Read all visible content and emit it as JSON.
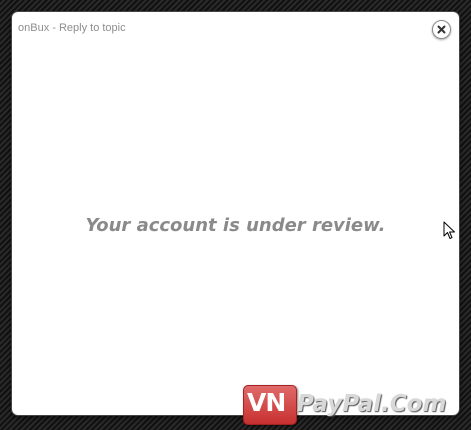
{
  "dialog": {
    "title": "onBux - Reply to topic",
    "message": "Your account is under review."
  },
  "watermark": {
    "prefix": "VN",
    "rest": "PayPal.Com"
  },
  "colors": {
    "backdrop": "#1b1b1b",
    "dialog_background": "#ffffff",
    "title_text": "#8d8d8d",
    "message_text": "#8a8a8a",
    "watermark_red": "#c83030"
  },
  "icons": {
    "close": "close-icon",
    "cursor": "mouse-cursor-icon"
  }
}
